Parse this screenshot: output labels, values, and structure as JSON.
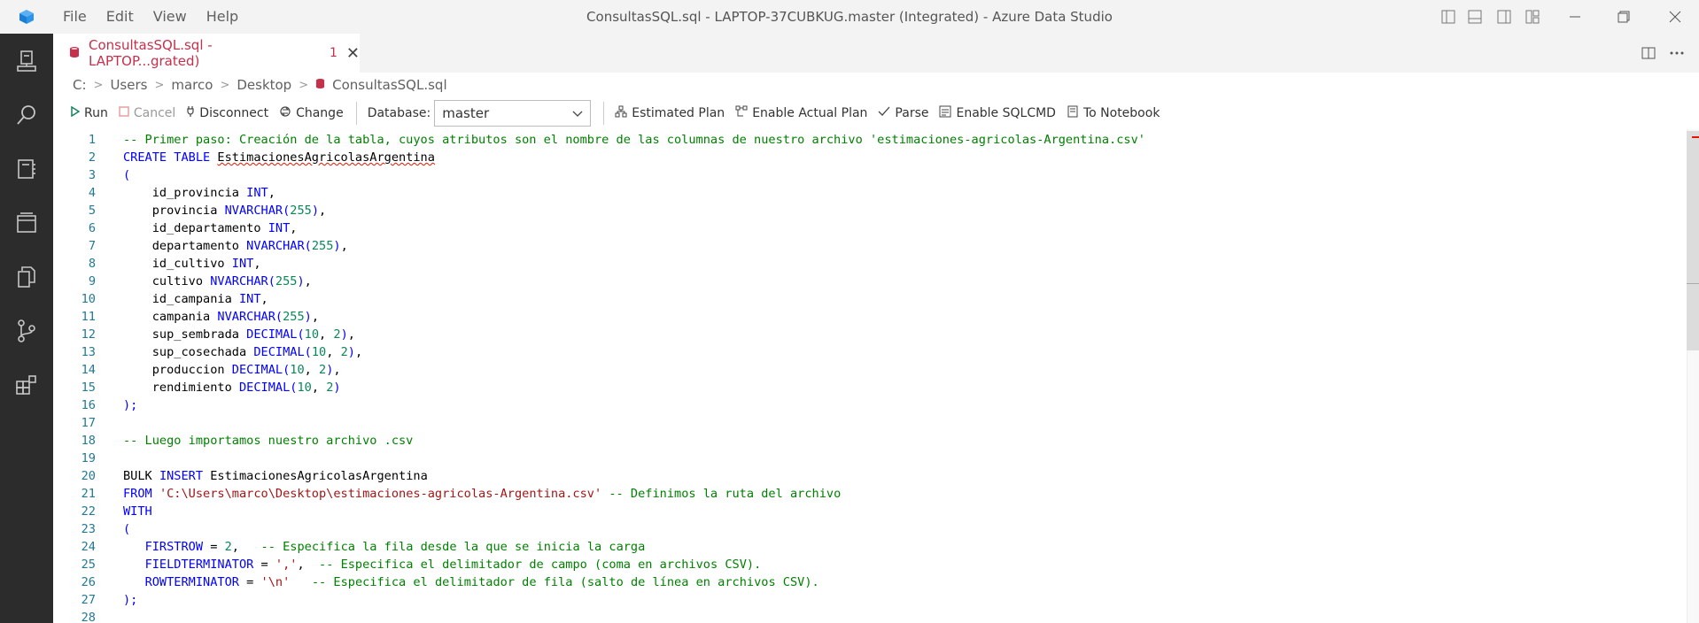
{
  "titlebar": {
    "window_title": "ConsultasSQL.sql - LAPTOP-37CUBKUG.master (Integrated) - Azure Data Studio",
    "menu": [
      "File",
      "Edit",
      "View",
      "Help"
    ]
  },
  "tab": {
    "title": "ConsultasSQL.sql - LAPTOP...grated)",
    "problem_count": "1",
    "close_glyph": "✕"
  },
  "breadcrumb": [
    "C:",
    "Users",
    "marco",
    "Desktop",
    "ConsultasSQL.sql"
  ],
  "toolbar": {
    "run": "Run",
    "cancel": "Cancel",
    "disconnect": "Disconnect",
    "change": "Change",
    "database_label": "Database:",
    "database_value": "master",
    "estimated_plan": "Estimated Plan",
    "enable_actual_plan": "Enable Actual Plan",
    "parse": "Parse",
    "enable_sqlcmd": "Enable SQLCMD",
    "to_notebook": "To Notebook"
  },
  "editor": {
    "line_numbers": [
      "1",
      "2",
      "3",
      "4",
      "5",
      "6",
      "7",
      "8",
      "9",
      "10",
      "11",
      "12",
      "13",
      "14",
      "15",
      "16",
      "17",
      "18",
      "19",
      "20",
      "21",
      "22",
      "23",
      "24",
      "25",
      "26",
      "27",
      "28"
    ],
    "l1": "-- Primer paso: Creación de la tabla, cuyos atributos son el nombre de las columnas de nuestro archivo 'estimaciones-agricolas-Argentina.csv'",
    "create_table": "CREATE TABLE",
    "table_name": "EstimacionesAgricolasArgentina",
    "open_paren": "(",
    "close_paren_semi": ");",
    "int": "INT",
    "nvarchar": "NVARCHAR",
    "decimal": "DECIMAL",
    "cols": [
      "id_provincia",
      "provincia",
      "id_departamento",
      "departamento",
      "id_cultivo",
      "cultivo",
      "id_campania",
      "campania",
      "sup_sembrada",
      "sup_cosechada",
      "produccion",
      "rendimiento"
    ],
    "l18": "-- Luego importamos nuestro archivo .csv",
    "bulk": "BULK",
    "insert": "INSERT",
    "from": "FROM",
    "path": "'C:\\Users\\marco\\Desktop\\estimaciones-agricolas-Argentina.csv'",
    "l21_comment": "-- Definimos la ruta del archivo",
    "with": "WITH",
    "firstrow": "FIRSTROW",
    "fieldterminator": "FIELDTERMINATOR",
    "rowterminator": "ROWTERMINATOR",
    "comma_str": "','",
    "newline_str": "'\\n'",
    "l24_comment": "-- Especifica la fila desde la que se inicia la carga",
    "l25_comment": "-- Especifica el delimitador de campo (coma en archivos CSV).",
    "l26_comment": "-- Especifica el delimitador de fila (salto de línea en archivos CSV)."
  }
}
